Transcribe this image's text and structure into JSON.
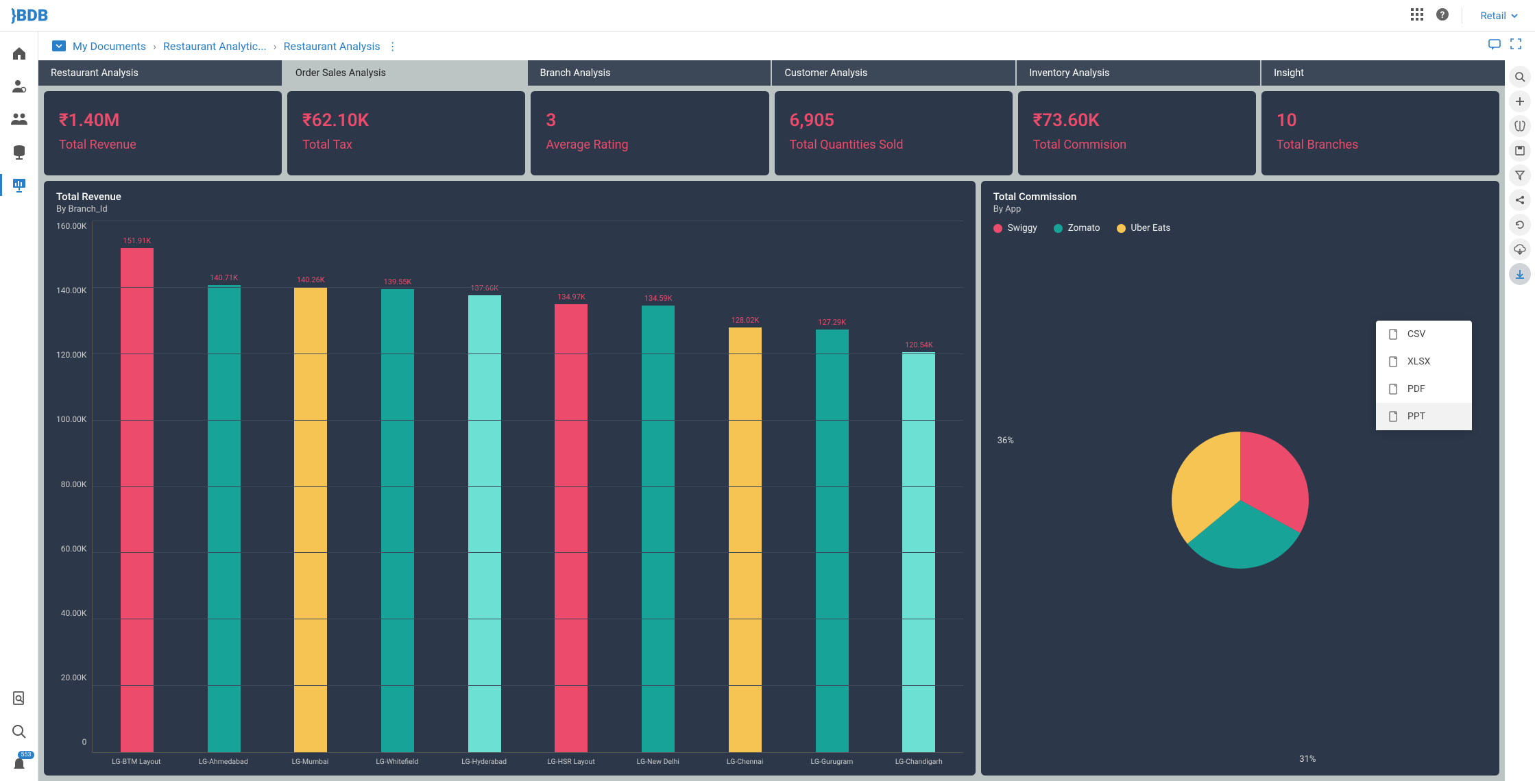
{
  "topbar": {
    "brand_dropdown": "Retail"
  },
  "sidebar": {
    "notification_count": "553"
  },
  "breadcrumb": {
    "root": "My Documents",
    "mid": "Restaurant Analytic...",
    "current": "Restaurant Analysis"
  },
  "tabs": [
    "Restaurant Analysis",
    "Order Sales Analysis",
    "Branch Analysis",
    "Customer Analysis",
    "Inventory Analysis",
    "Insight"
  ],
  "kpis": [
    {
      "value": "₹1.40M",
      "label": "Total Revenue"
    },
    {
      "value": "₹62.10K",
      "label": "Total Tax"
    },
    {
      "value": "3",
      "label": "Average Rating"
    },
    {
      "value": "6,905",
      "label": "Total Quantities Sold"
    },
    {
      "value": "₹73.60K",
      "label": "Total Commision"
    },
    {
      "value": "10",
      "label": "Total Branches"
    }
  ],
  "chart_revenue": {
    "title": "Total Revenue",
    "subtitle": "By Branch_Id"
  },
  "chart_commission": {
    "title": "Total Commission",
    "subtitle": "By App",
    "legend": [
      "Swiggy",
      "Zomato",
      "Uber Eats"
    ],
    "colors": {
      "Swiggy": "#ec4b6c",
      "Zomato": "#17a398",
      "Uber Eats": "#f6c453"
    },
    "labels": {
      "left": "36%",
      "bottom": "31%"
    }
  },
  "export_menu": [
    "CSV",
    "XLSX",
    "PDF",
    "PPT"
  ],
  "chart_data": [
    {
      "type": "bar",
      "title": "Total Revenue",
      "subtitle": "By Branch_Id",
      "ylabel": "",
      "ylim": [
        0,
        160000
      ],
      "yticks": [
        "160.00K",
        "140.00K",
        "120.00K",
        "100.00K",
        "80.00K",
        "60.00K",
        "40.00K",
        "20.00K",
        "0"
      ],
      "categories": [
        "LG-BTM Layout",
        "LG-Ahmedabad",
        "LG-Mumbai",
        "LG-Whitefield",
        "LG-Hyderabad",
        "LG-HSR Layout",
        "LG-New Delhi",
        "LG-Chennai",
        "LG-Gurugram",
        "LG-Chandigarh"
      ],
      "values": [
        151.91,
        140.71,
        140.26,
        139.55,
        137.66,
        134.97,
        134.59,
        128.02,
        127.29,
        120.54
      ],
      "value_labels": [
        "151.91K",
        "140.71K",
        "140.26K",
        "139.55K",
        "137.66K",
        "134.97K",
        "134.59K",
        "128.02K",
        "127.29K",
        "120.54K"
      ],
      "bar_colors": [
        "#ec4b6c",
        "#17a398",
        "#f6c453",
        "#17a398",
        "#6de0d4",
        "#ec4b6c",
        "#17a398",
        "#f6c453",
        "#17a398",
        "#6de0d4"
      ]
    },
    {
      "type": "pie",
      "title": "Total Commission",
      "subtitle": "By App",
      "series": [
        {
          "name": "Swiggy",
          "value": 33,
          "color": "#ec4b6c"
        },
        {
          "name": "Zomato",
          "value": 31,
          "color": "#17a398"
        },
        {
          "name": "Uber Eats",
          "value": 36,
          "color": "#f6c453"
        }
      ],
      "visible_labels": [
        "36%",
        "31%"
      ]
    }
  ]
}
